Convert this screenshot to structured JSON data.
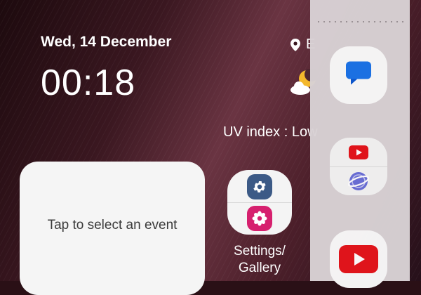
{
  "clock": {
    "date": "Wed, 14 December",
    "time": "00:18"
  },
  "weather": {
    "location": "E",
    "uv_index": "UV index : Low",
    "icon": "partly-cloudy-moon-icon"
  },
  "event_widget": {
    "text": "Tap to select an event"
  },
  "home_folder": {
    "label": "Settings/\nGallery",
    "apps": [
      "settings-icon",
      "gallery-icon"
    ]
  },
  "edge_panel": {
    "apps": [
      "messages-icon",
      "youtube-internet-pair-icon",
      "youtube-icon"
    ]
  },
  "colors": {
    "settings_bg": "#3c5a86",
    "gallery_bg": "#d6206e",
    "messages_blue": "#1a73e8",
    "youtube_red": "#e5141b",
    "internet_purple": "#6a6fd8"
  }
}
